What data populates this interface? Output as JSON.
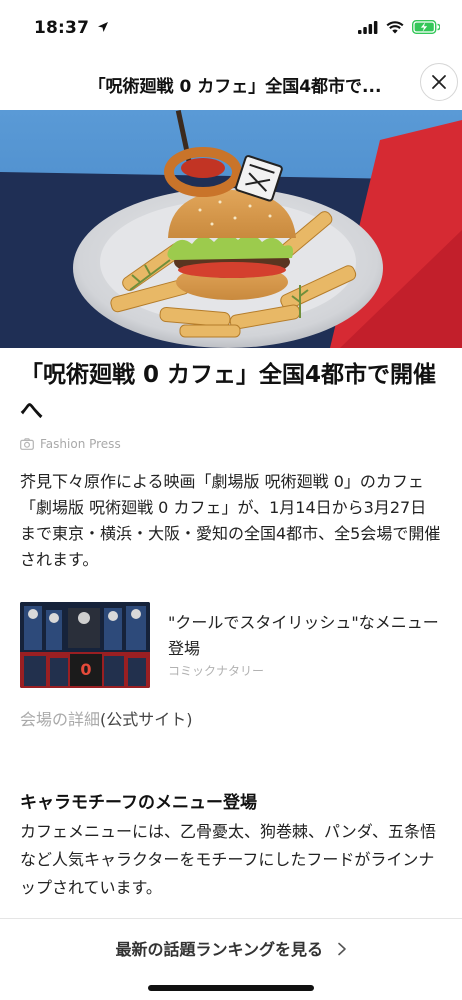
{
  "status": {
    "time": "18:37"
  },
  "header": {
    "title": "「呪術廻戦 0 カフェ」全国4都市で..."
  },
  "article": {
    "title": "「呪術廻戦 0 カフェ」全国4都市で開催へ",
    "source": "Fashion Press",
    "lead": "芥見下々原作による映画「劇場版 呪術廻戦 0」のカフェ「劇場版 呪術廻戦 0 カフェ」が、1月14日から3月27日まで東京・横浜・大阪・愛知の全国4都市、全5会場で開催されます。"
  },
  "related": {
    "title": "\"クールでスタイリッシュ\"なメニュー登場",
    "source": "コミックナタリー"
  },
  "venue": {
    "muted": "会場の詳細",
    "text": "(公式サイト)"
  },
  "section": {
    "heading": "キャラモチーフのメニュー登場",
    "body": "カフェメニューには、乙骨憂太、狗巻棘、パンダ、五条悟など人気キャラクターをモチーフにしたフードがラインナップされています。"
  },
  "footer": {
    "ranking_label": "最新の話題ランキングを見る"
  },
  "colors": {
    "battery": "#34c759",
    "tablecloth_blue": "#1f2f55",
    "tablecloth_red": "#d62a33"
  }
}
